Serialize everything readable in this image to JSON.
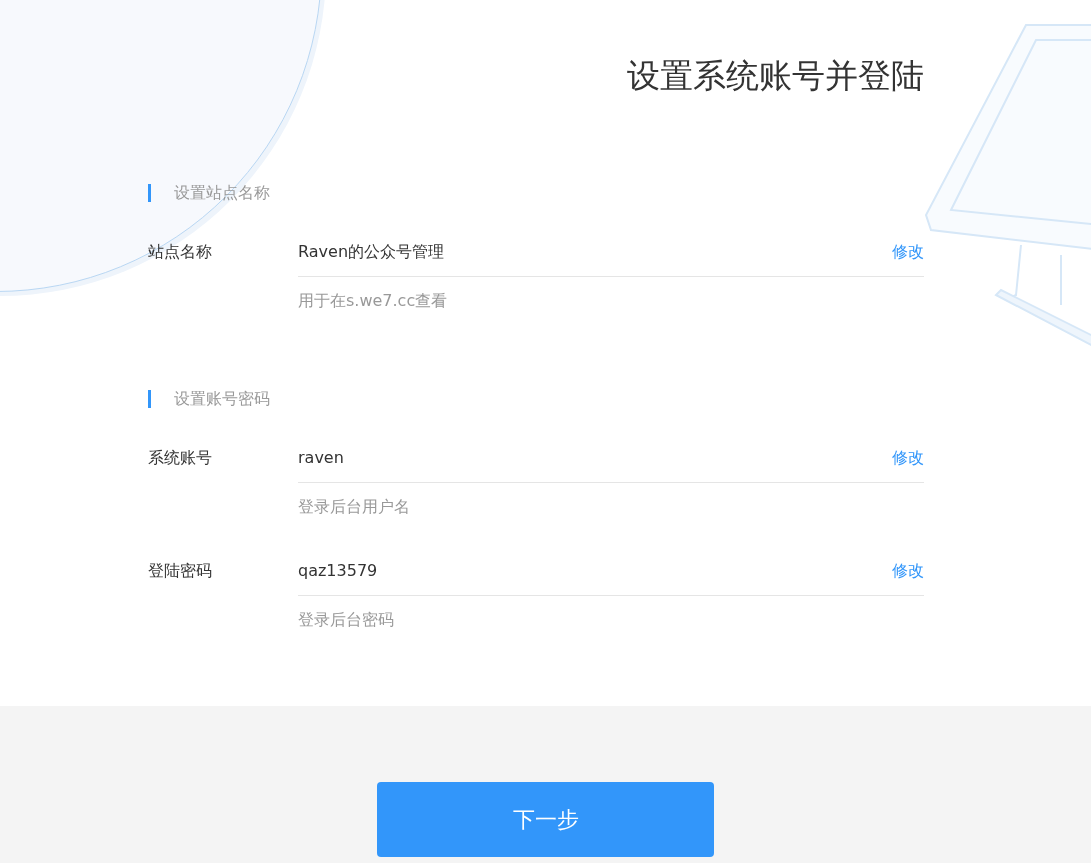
{
  "title": "设置系统账号并登陆",
  "sections": [
    {
      "heading": "设置站点名称",
      "fields": [
        {
          "label": "站点名称",
          "value": "Raven的公众号管理",
          "action": "修改",
          "hint": "用于在s.we7.cc查看"
        }
      ]
    },
    {
      "heading": "设置账号密码",
      "fields": [
        {
          "label": "系统账号",
          "value": "raven",
          "action": "修改",
          "hint": "登录后台用户名"
        },
        {
          "label": "登陆密码",
          "value": "qaz13579",
          "action": "修改",
          "hint": "登录后台密码"
        }
      ]
    }
  ],
  "next_button": "下一步"
}
